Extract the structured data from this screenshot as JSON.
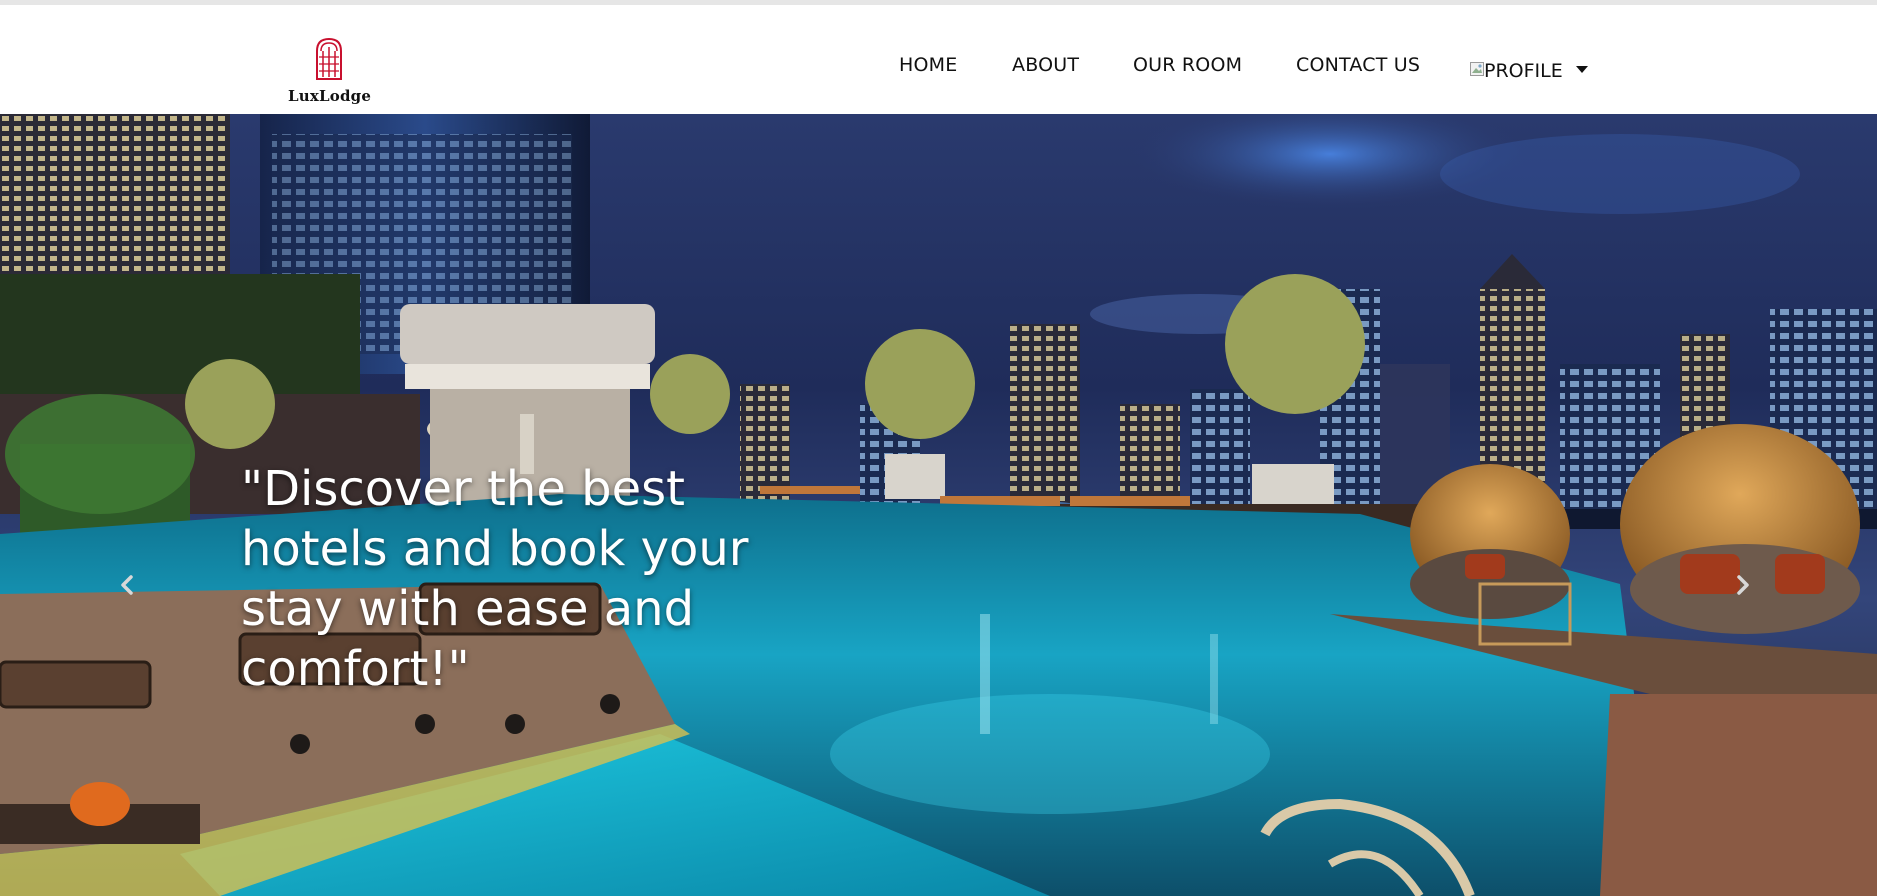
{
  "brand": {
    "name": "LuxLodge",
    "logo_color": "#c8102e"
  },
  "nav": {
    "items": [
      {
        "label": "HOME"
      },
      {
        "label": "ABOUT"
      },
      {
        "label": "OUR ROOM"
      },
      {
        "label": "CONTACT US"
      }
    ],
    "profile_label": "PROFILE"
  },
  "hero": {
    "caption": "\"Discover the best hotels and book your stay with ease and comfort!\"",
    "prev_icon": "chevron-left-icon",
    "next_icon": "chevron-right-icon"
  },
  "colors": {
    "sky": "#1f2c5a",
    "pool": "#18b6d6",
    "caption_text": "#ffffff"
  }
}
